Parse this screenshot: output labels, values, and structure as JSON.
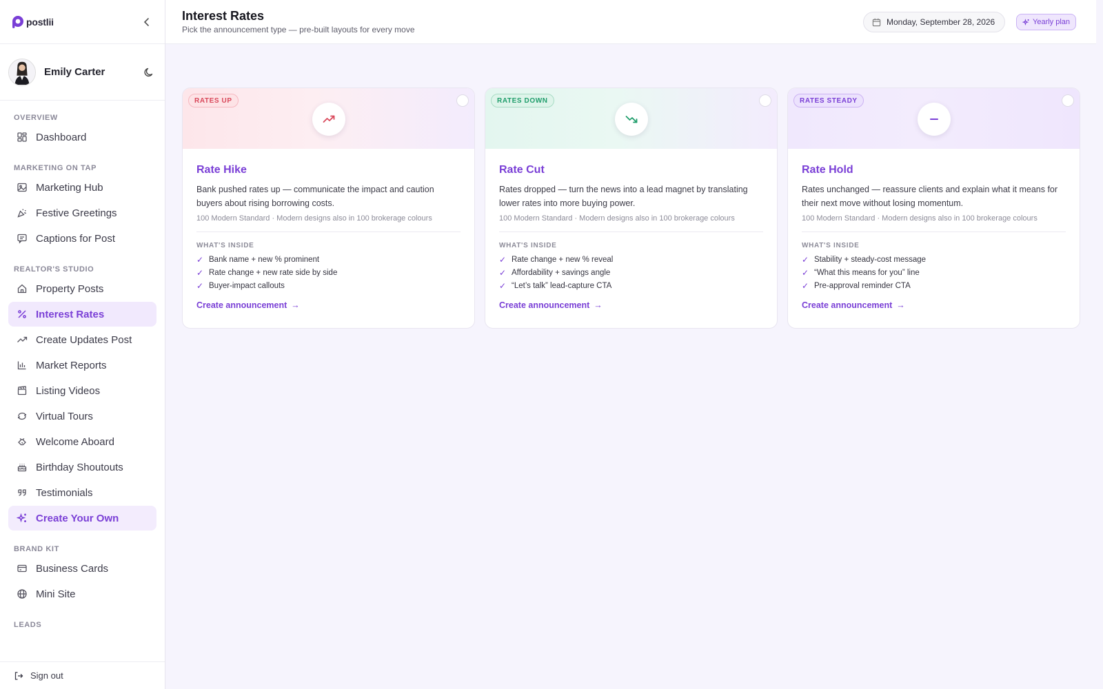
{
  "brand": {
    "name": "postlii"
  },
  "profile": {
    "name": "Emily Carter"
  },
  "sidebar": {
    "sections": [
      {
        "label": "OVERVIEW",
        "items": [
          {
            "label": "Dashboard",
            "icon": "dashboard-icon"
          }
        ]
      },
      {
        "label": "MARKETING ON TAP",
        "items": [
          {
            "label": "Marketing Hub",
            "icon": "image-icon"
          },
          {
            "label": "Festive Greetings",
            "icon": "party-icon"
          },
          {
            "label": "Captions for Post",
            "icon": "message-icon"
          }
        ]
      },
      {
        "label": "REALTOR'S STUDIO",
        "items": [
          {
            "label": "Property Posts",
            "icon": "home-icon"
          },
          {
            "label": "Interest Rates",
            "icon": "percent-icon",
            "active": true
          },
          {
            "label": "Create Updates Post",
            "icon": "trending-icon"
          },
          {
            "label": "Market Reports",
            "icon": "bar-chart-icon"
          },
          {
            "label": "Listing Videos",
            "icon": "clapper-icon"
          },
          {
            "label": "Virtual Tours",
            "icon": "rotate-icon"
          },
          {
            "label": "Welcome Aboard",
            "icon": "handshake-icon"
          },
          {
            "label": "Birthday Shoutouts",
            "icon": "cake-icon"
          },
          {
            "label": "Testimonials",
            "icon": "quote-icon"
          },
          {
            "label": "Create Your Own",
            "icon": "sparkles-icon",
            "featured": true
          }
        ]
      },
      {
        "label": "BRAND KIT",
        "items": [
          {
            "label": "Business Cards",
            "icon": "card-icon"
          },
          {
            "label": "Mini Site",
            "icon": "globe-icon"
          }
        ]
      },
      {
        "label": "LEADS",
        "items": []
      }
    ],
    "signout_label": "Sign out"
  },
  "header": {
    "title": "Interest Rates",
    "subtitle": "Pick the announcement type — pre-built layouts for every move",
    "date": "Monday, September 28, 2026",
    "plan": "Yearly plan"
  },
  "cards": [
    {
      "badge": "RATES UP",
      "title": "Rate Hike",
      "description": "Bank pushed rates up — communicate the impact and caution buyers about rising borrowing costs.",
      "meta": "100 Modern Standard · Modern designs also in 100 brokerage colours",
      "inside_label": "WHAT'S INSIDE",
      "features": [
        "Bank name + new % prominent",
        "Rate change + new rate side by side",
        "Buyer-impact callouts"
      ],
      "cta": "Create announcement",
      "accent": "#d9475a"
    },
    {
      "badge": "RATES DOWN",
      "title": "Rate Cut",
      "description": "Rates dropped — turn the news into a lead magnet by translating lower rates into more buying power.",
      "meta": "100 Modern Standard · Modern designs also in 100 brokerage colours",
      "inside_label": "WHAT'S INSIDE",
      "features": [
        "Rate change + new % reveal",
        "Affordability + savings angle",
        "“Let’s talk” lead-capture CTA"
      ],
      "cta": "Create announcement",
      "accent": "#1f9d6b"
    },
    {
      "badge": "RATES STEADY",
      "title": "Rate Hold",
      "description": "Rates unchanged — reassure clients and explain what it means for their next move without losing momentum.",
      "meta": "100 Modern Standard · Modern designs also in 100 brokerage colours",
      "inside_label": "WHAT'S INSIDE",
      "features": [
        "Stability + steady-cost message",
        "“What this means for you” line",
        "Pre-approval reminder CTA"
      ],
      "cta": "Create announcement",
      "accent": "#7a3fd6"
    }
  ],
  "colors": {
    "accent": "#7a3fd6",
    "active_bg": "#f1e9fd",
    "page_bg": "#f6f4fd"
  }
}
